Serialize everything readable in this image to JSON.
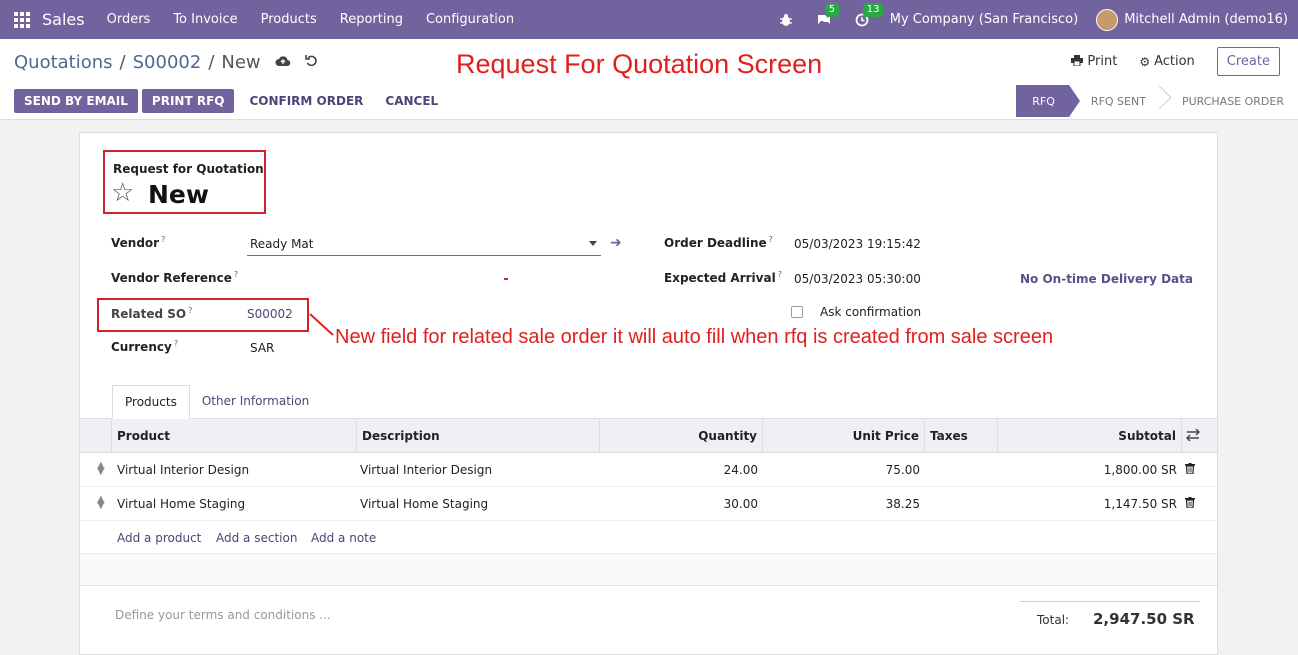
{
  "navbar": {
    "brand": "Sales",
    "menu": [
      "Orders",
      "To Invoice",
      "Products",
      "Reporting",
      "Configuration"
    ],
    "chat_count": "5",
    "activity_count": "13",
    "company": "My Company (San Francisco)",
    "user": "Mitchell Admin (demo16)"
  },
  "breadcrumb": {
    "root": "Quotations",
    "order": "S00002",
    "current": "New",
    "sep": "/"
  },
  "annotation_title": "Request For Quotation Screen",
  "toolbar": {
    "print": "Print",
    "action": "Action",
    "create": "Create"
  },
  "actions": {
    "send_email": "SEND BY EMAIL",
    "print_rfq": "PRINT RFQ",
    "confirm": "CONFIRM ORDER",
    "cancel": "CANCEL"
  },
  "statusbar": [
    "RFQ",
    "RFQ SENT",
    "PURCHASE ORDER"
  ],
  "form": {
    "doc_kind": "Request for Quotation",
    "doc_name": "New",
    "vendor_label": "Vendor",
    "vendor_value": "Ready Mat",
    "vendor_ref_label": "Vendor Reference",
    "related_so_label": "Related SO",
    "related_so_value": "S00002",
    "currency_label": "Currency",
    "currency_value": "SAR",
    "order_deadline_label": "Order Deadline",
    "order_deadline_value": "05/03/2023 19:15:42",
    "expected_arrival_label": "Expected Arrival",
    "expected_arrival_value": "05/03/2023 05:30:00",
    "ontime": "No On-time Delivery Data",
    "ask_confirmation": "Ask confirmation",
    "help_mark": "?"
  },
  "annotation_so": "New field for related sale order it will auto fill when rfq is created from sale screen",
  "tabs": [
    "Products",
    "Other Information"
  ],
  "table": {
    "headers": {
      "product": "Product",
      "description": "Description",
      "quantity": "Quantity",
      "unit_price": "Unit Price",
      "taxes": "Taxes",
      "subtotal": "Subtotal"
    },
    "rows": [
      {
        "product": "Virtual Interior Design",
        "description": "Virtual Interior Design",
        "quantity": "24.00",
        "unit_price": "75.00",
        "subtotal": "1,800.00 SR"
      },
      {
        "product": "Virtual Home Staging",
        "description": "Virtual Home Staging",
        "quantity": "30.00",
        "unit_price": "38.25",
        "subtotal": "1,147.50 SR"
      }
    ],
    "add_product": "Add a product",
    "add_section": "Add a section",
    "add_note": "Add a note"
  },
  "terms_placeholder": "Define your terms and conditions ...",
  "total": {
    "label": "Total:",
    "value": "2,947.50 SR"
  }
}
